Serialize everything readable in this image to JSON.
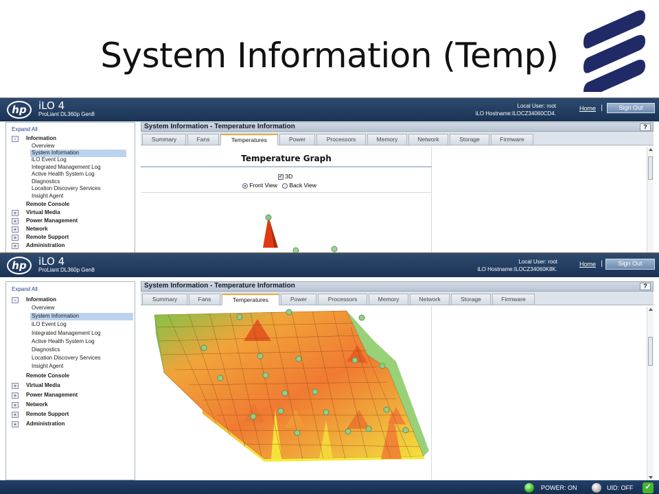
{
  "slide": {
    "title": "System Information (Temp)"
  },
  "banner": {
    "product": "iLO 4",
    "model": "ProLiant DL360p Gen8",
    "user_line": "Local User:  root",
    "hostname_line_1": "iLO Hostname:ILOCZ34060CD4.",
    "hostname_line_2": "iLO Hostname:ILOCZ34060K8K.",
    "home_label": "Home",
    "separator": "|",
    "signout_label": "Sign Out",
    "hp_logo_text": "hp"
  },
  "nav": {
    "expand_all": "Expand All",
    "information": "Information",
    "items": [
      "Overview",
      "System Information",
      "iLO Event Log",
      "Integrated Management Log",
      "Active Health System Log",
      "Diagnostics",
      "Location Discovery Services",
      "Insight Agent"
    ],
    "remote_console": "Remote Console",
    "sections": [
      "Virtual Media",
      "Power Management",
      "Network",
      "Remote Support",
      "Administration"
    ],
    "collapse_glyph": "-",
    "expand_glyph": "+"
  },
  "panel": {
    "title": "System Information - Temperature Information",
    "help_label": "?",
    "tabs": [
      "Summary",
      "Fans",
      "Temperatures",
      "Power",
      "Processors",
      "Memory",
      "Network",
      "Storage",
      "Firmware"
    ],
    "active_tab": "Temperatures"
  },
  "graph": {
    "title": "Temperature Graph",
    "option_3d": "3D",
    "front_view": "Front View",
    "back_view": "Back View",
    "check_glyph": "✓"
  },
  "status": {
    "power": "POWER: ON",
    "uid": "UID: OFF",
    "ok_glyph": "✓"
  },
  "colors": {
    "banner": "#1a3355",
    "logo_navy": "#1f2a66",
    "nav_link": "#1d3f8a",
    "selected_row": "#bcd3ee"
  }
}
